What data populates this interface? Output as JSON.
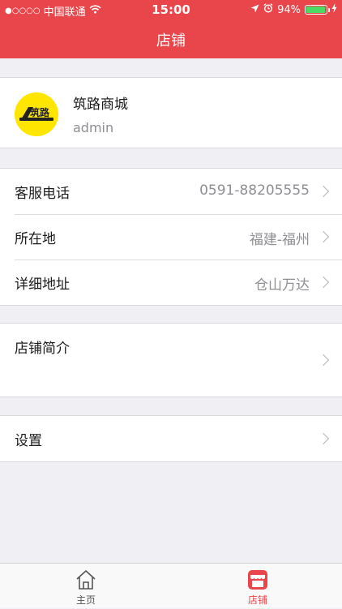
{
  "status_bar": {
    "signal": "●○○○○",
    "carrier": "中国联通",
    "time": "15:00",
    "battery": "94%",
    "battery_level": 0.94
  },
  "nav": {
    "title": "店铺"
  },
  "profile": {
    "logo_text": "筑路",
    "name": "筑路商城",
    "username": "admin"
  },
  "info_rows": [
    {
      "label": "客服电话",
      "value": "0591-88205555"
    },
    {
      "label": "所在地",
      "value": "福建-福州"
    },
    {
      "label": "详细地址",
      "value": "仓山万达"
    }
  ],
  "intro": {
    "label": "店铺简介"
  },
  "settings": {
    "label": "设置"
  },
  "tabbar": {
    "items": [
      {
        "label": "主页",
        "icon": "home-icon",
        "active": false
      },
      {
        "label": "店铺",
        "icon": "store-icon",
        "active": true
      }
    ],
    "active_color": "#e8464b",
    "inactive_color": "#555555"
  },
  "colors": {
    "brand": "#e8464b",
    "avatar_bg": "#ffe600",
    "battery": "#4cd964"
  }
}
